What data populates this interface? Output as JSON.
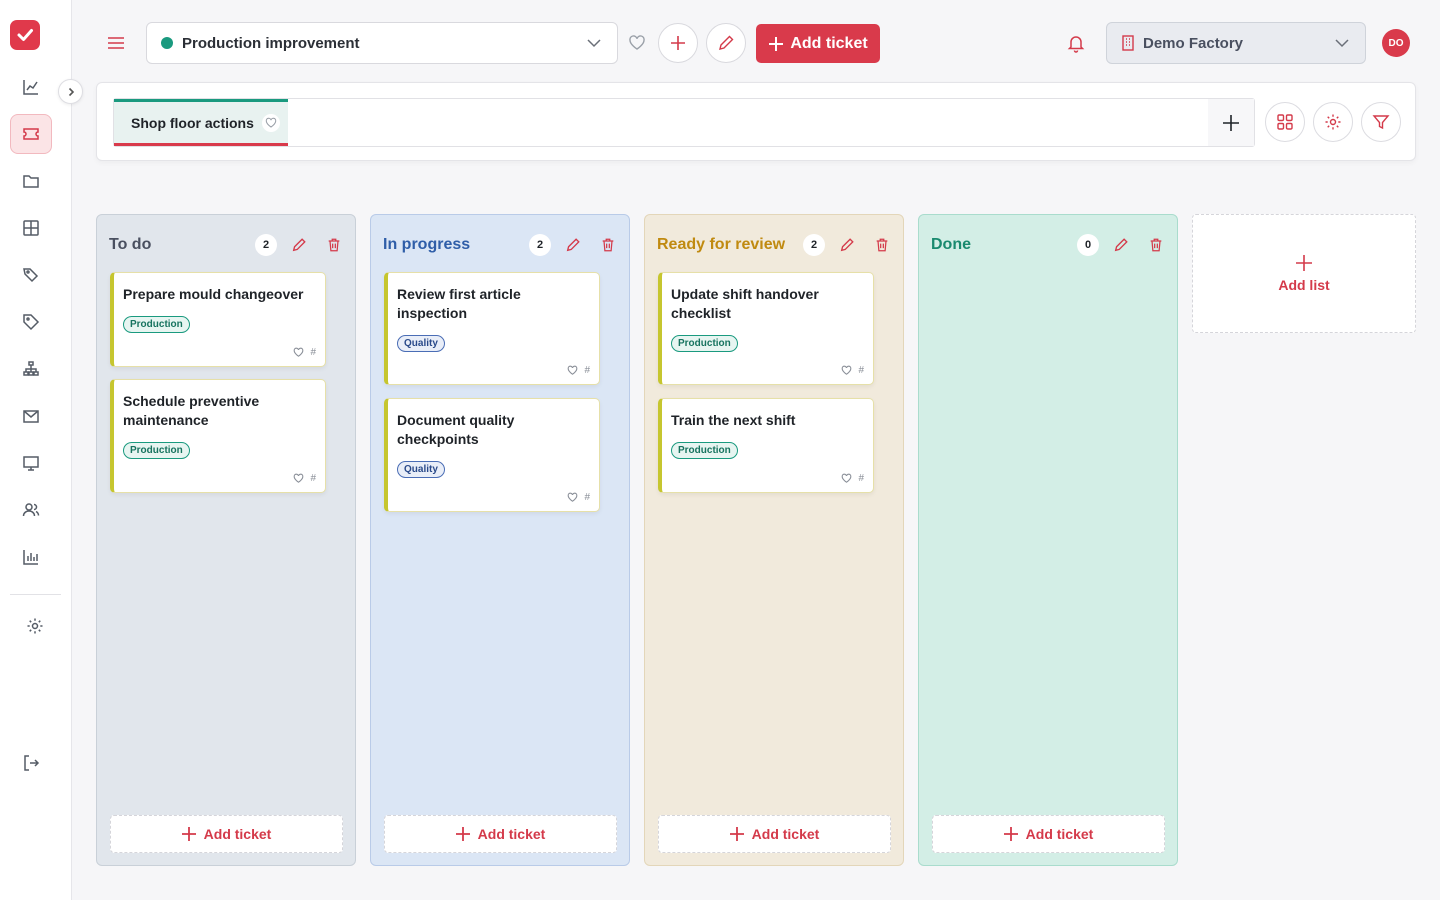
{
  "header": {
    "project_name": "Production improvement",
    "add_ticket_label": "Add ticket",
    "factory_name": "Demo Factory",
    "avatar_initials": "DO"
  },
  "board": {
    "active_tab": "Shop floor actions"
  },
  "columns": [
    {
      "title": "To do",
      "count": "2",
      "title_color": "#4a5060",
      "cards": [
        {
          "title": "Prepare mould changeover",
          "tag": "Production"
        },
        {
          "title": "Schedule preventive maintenance",
          "tag": "Production"
        }
      ],
      "add_label": "Add ticket"
    },
    {
      "title": "In progress",
      "count": "2",
      "title_color": "#2f5ea8",
      "cards": [
        {
          "title": "Review first article inspection",
          "tag": "Quality"
        },
        {
          "title": "Document quality checkpoints",
          "tag": "Quality"
        }
      ],
      "add_label": "Add ticket"
    },
    {
      "title": "Ready for review",
      "count": "2",
      "title_color": "#c08a10",
      "cards": [
        {
          "title": "Update shift handover checklist",
          "tag": "Production"
        },
        {
          "title": "Train the next shift",
          "tag": "Production"
        }
      ],
      "add_label": "Add ticket"
    },
    {
      "title": "Done",
      "count": "0",
      "title_color": "#1a8a6f",
      "cards": [],
      "add_label": "Add ticket"
    }
  ],
  "add_list_label": "Add list",
  "card_hash": "#",
  "colors": {
    "accent": "#d93a4b",
    "project_dot": "#1a9a7f",
    "col_todo_bg": "#e1e6ec",
    "col_progress_bg": "#dbe6f5",
    "col_review_bg": "#f1eadc",
    "col_done_bg": "#d3eee6"
  }
}
